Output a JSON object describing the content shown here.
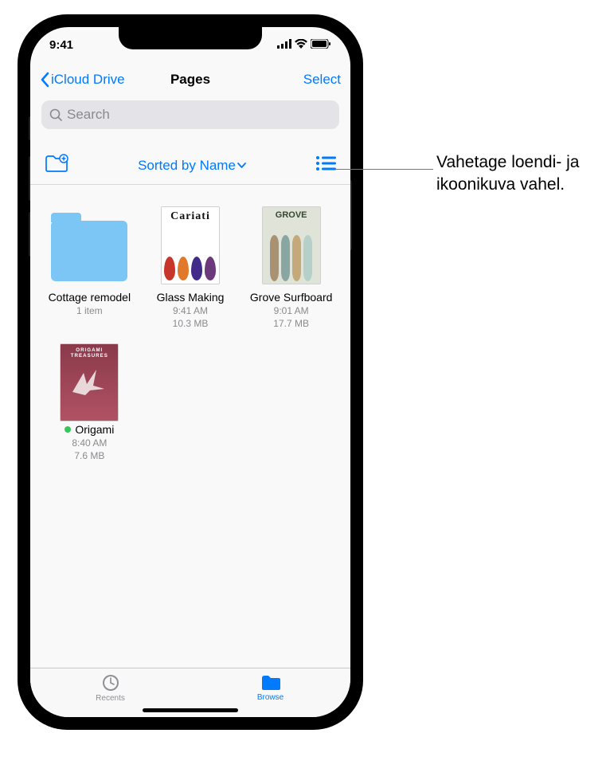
{
  "status": {
    "time": "9:41"
  },
  "nav": {
    "back_label": "iCloud Drive",
    "title": "Pages",
    "select_label": "Select"
  },
  "search": {
    "placeholder": "Search"
  },
  "toolbar": {
    "sort_label": "Sorted by Name"
  },
  "files": [
    {
      "name": "Cottage remodel",
      "meta1": "1 item",
      "meta2": "",
      "type": "folder"
    },
    {
      "name": "Glass Making",
      "meta1": "9:41 AM",
      "meta2": "10.3 MB",
      "type": "doc",
      "thumb_label": "Cariati"
    },
    {
      "name": "Grove Surfboard",
      "meta1": "9:01 AM",
      "meta2": "17.7 MB",
      "type": "doc",
      "thumb_label": "GROVE"
    },
    {
      "name": "Origami",
      "meta1": "8:40 AM",
      "meta2": "7.6 MB",
      "type": "doc",
      "thumb_label": "ORIGAMI TREASURES",
      "tagged": true
    }
  ],
  "tabs": {
    "recents": "Recents",
    "browse": "Browse"
  },
  "callout": {
    "text": "Vahetage loendi- ja ikoonikuva vahel."
  }
}
